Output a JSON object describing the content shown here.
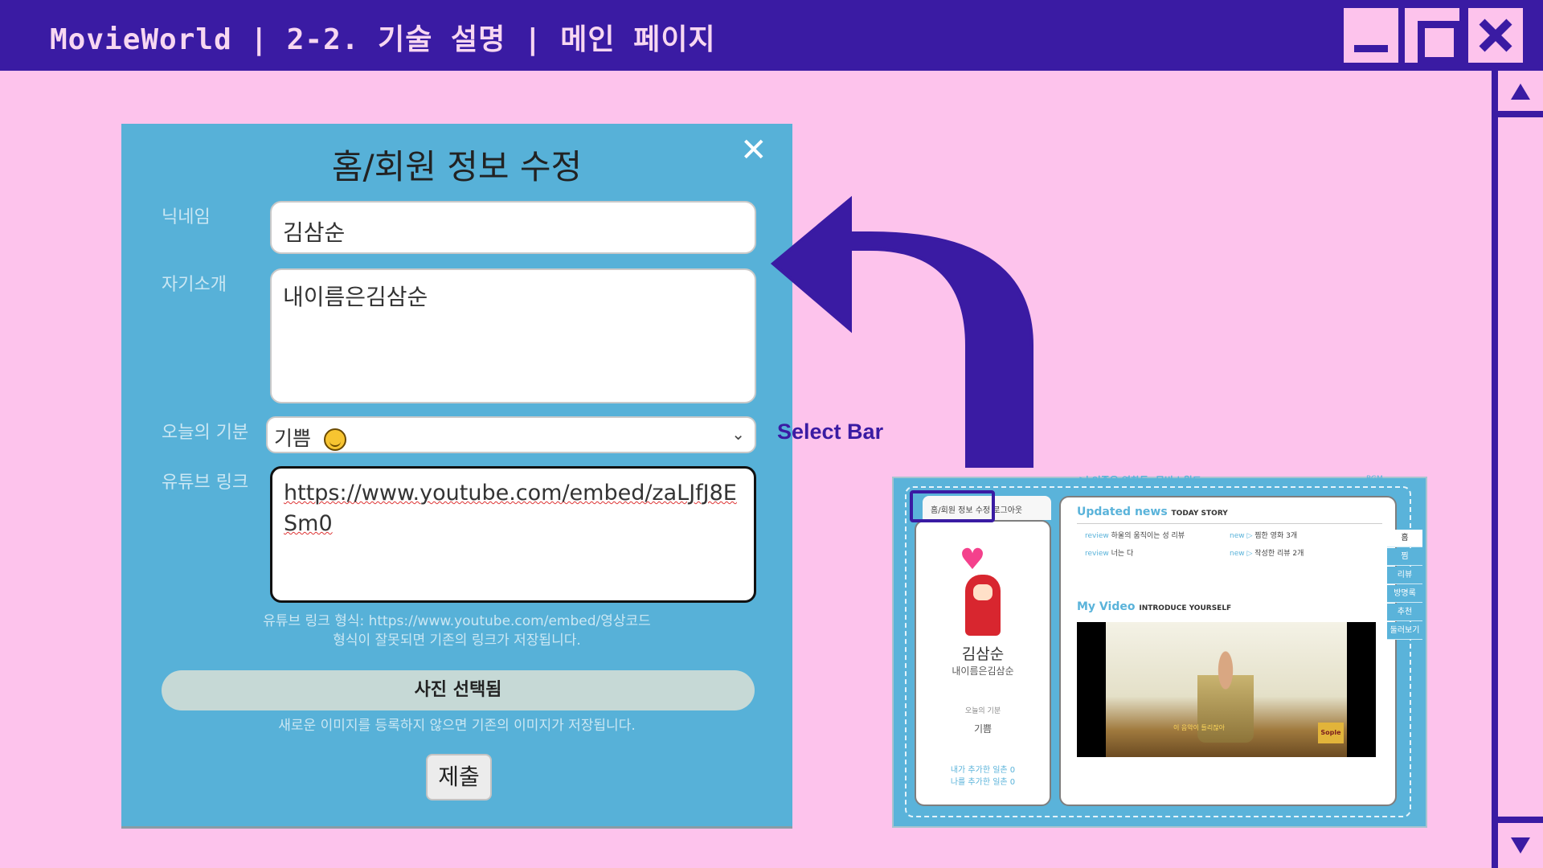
{
  "window": {
    "title": "MovieWorld | 2-2. 기술 설명 | 메인 페이지"
  },
  "modal": {
    "title": "홈/회원 정보 수정",
    "close": "✕",
    "nickname_label": "닉네임",
    "nickname_value": "김삼순",
    "intro_label": "자기소개",
    "intro_value": "내이름은김삼순",
    "mood_label": "오늘의 기분",
    "mood_value": "기쁨",
    "mood_chevron": "⌄",
    "youtube_label": "유튜브 링크",
    "youtube_value": "https://www.youtube.com/embed/zaLJfJ8ESm0",
    "youtube_hint_1": "유튜브 링크 형식: https://www.youtube.com/embed/영상코드",
    "youtube_hint_2": "형식이 잘못되면 기존의 링크가 저장됩니다.",
    "photo_button": "사진 선택됨",
    "photo_hint": "새로운 이미지를 등록하지 않으면 기존의 이미지가 저장됩니다.",
    "submit_button": "제출"
  },
  "annotation": {
    "select_bar": "Select Bar"
  },
  "mini_page": {
    "tab_edit": "홈/회원 정보 수정",
    "tab_logout": "로그아웃",
    "site_title": "♪ㅏ이좋은 영화들, 무비 | 월드",
    "bgm": "BGM",
    "heart": "♥",
    "name": "김삼순",
    "intro": "내이름은김삼순",
    "mood_label": "오늘의 기분",
    "mood_value": "기쁨",
    "my_ilchon": "내가 추가한 일촌 0",
    "other_ilchon": "나를 추가한 일촌 0",
    "updated_news": "Updated news",
    "today_story": "TODAY STORY",
    "news_1": "하울의 움직이는 성 리뷰",
    "news_2": "너는 다",
    "news_3": "찜한 영화 3개",
    "news_4": "작성한 리뷰 2개",
    "tag_review": "review",
    "tag_new": "new ▷",
    "my_video": "My Video",
    "introduce": "INTRODUCE YOURSELF",
    "video_caption": "이 음악이 들리잖아",
    "video_logo": "Sople",
    "side_tabs": [
      "홈",
      "찜",
      "리뷰",
      "방명록",
      "추천",
      "둘러보기"
    ]
  }
}
